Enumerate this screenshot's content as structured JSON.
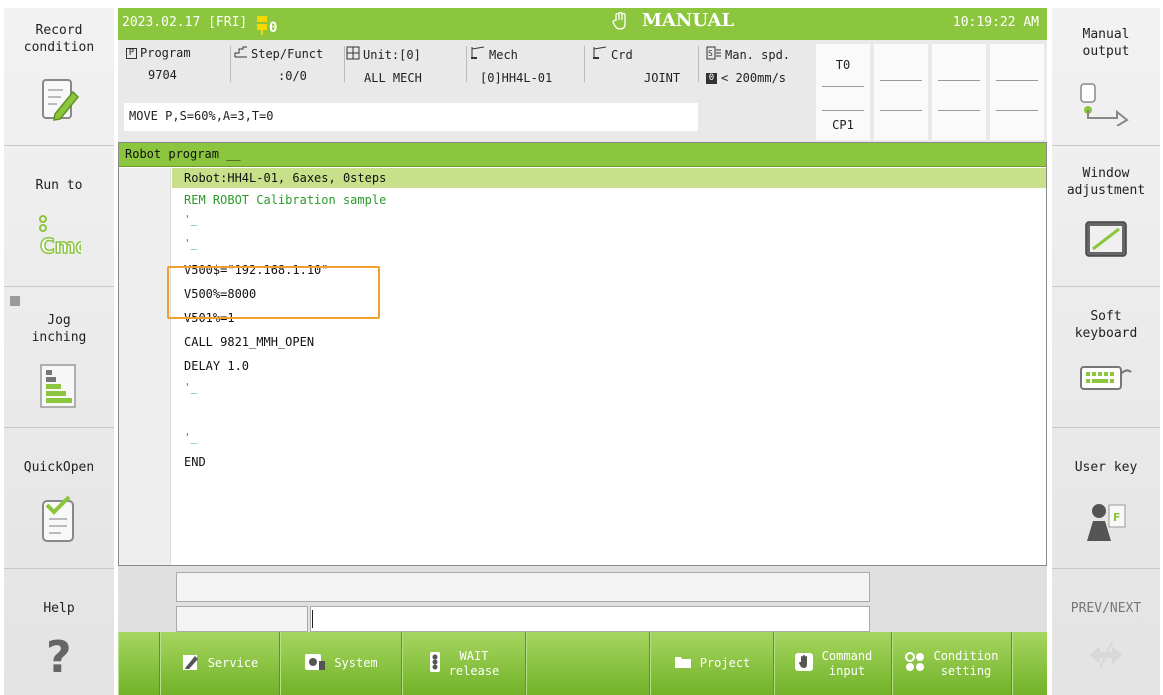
{
  "header": {
    "date": "2023.02.17 [FRI]",
    "flag_count": "0",
    "mode": "MANUAL",
    "time": "10:19:22 AM",
    "colors": {
      "bar": "#8cc63e",
      "text": "#ffffff"
    }
  },
  "left_panel": [
    {
      "label": "Record\ncondition",
      "icon": "pencil-note-icon"
    },
    {
      "label": "Run to",
      "icon": "cmd-icon"
    },
    {
      "label": "Jog\ninching",
      "icon": "step-bars-icon"
    },
    {
      "label": "QuickOpen",
      "icon": "checklist-icon"
    },
    {
      "label": "Help",
      "icon": "question-icon"
    }
  ],
  "right_panel": [
    {
      "label": "Manual\noutput",
      "icon": "output-icon"
    },
    {
      "label": "Window\nadjustment",
      "icon": "window-resize-icon"
    },
    {
      "label": "Soft\nkeyboard",
      "icon": "keyboard-icon"
    },
    {
      "label": "User key",
      "icon": "user-key-icon"
    },
    {
      "label": "PREV/NEXT",
      "icon": "prev-next-icon"
    }
  ],
  "info": {
    "program_label": "Program",
    "program_value": "9704",
    "step_label": "Step/Funct",
    "step_value": ":0/0",
    "unit_label": "Unit:[0]",
    "unit_value": "ALL MECH",
    "mech_label": "Mech",
    "mech_value": "[0]HH4L-01",
    "crd_label": "Crd",
    "crd_value": "JOINT",
    "speed_label": "Man. spd.",
    "speed_level": "0",
    "speed_value": "< 200mm/s",
    "tool_top": "T0",
    "tool_bottom": "CP1",
    "command_line": "MOVE P,S=60%,A=3,T=0"
  },
  "program": {
    "title": "Robot program",
    "lines": [
      "Robot:HH4L-01, 6axes, 0steps",
      "REM ROBOT Calibration sample",
      "'_",
      "'_",
      "V500$=\"192.168.1.10\"",
      "V500%=8000",
      "V501%=1",
      "CALL 9821_MMH_OPEN",
      "DELAY 1.0",
      "'_",
      "",
      "'_",
      "END"
    ]
  },
  "function_bar": [
    {
      "label": "Service",
      "icon": "service-icon"
    },
    {
      "label": "System",
      "icon": "system-icon"
    },
    {
      "label": "WAIT\nrelease",
      "icon": "traffic-light-icon"
    },
    {
      "label": "Project",
      "icon": "folder-icon"
    },
    {
      "label": "Command\ninput",
      "icon": "hand-command-icon"
    },
    {
      "label": "Condition\nsetting",
      "icon": "condition-icon"
    }
  ]
}
